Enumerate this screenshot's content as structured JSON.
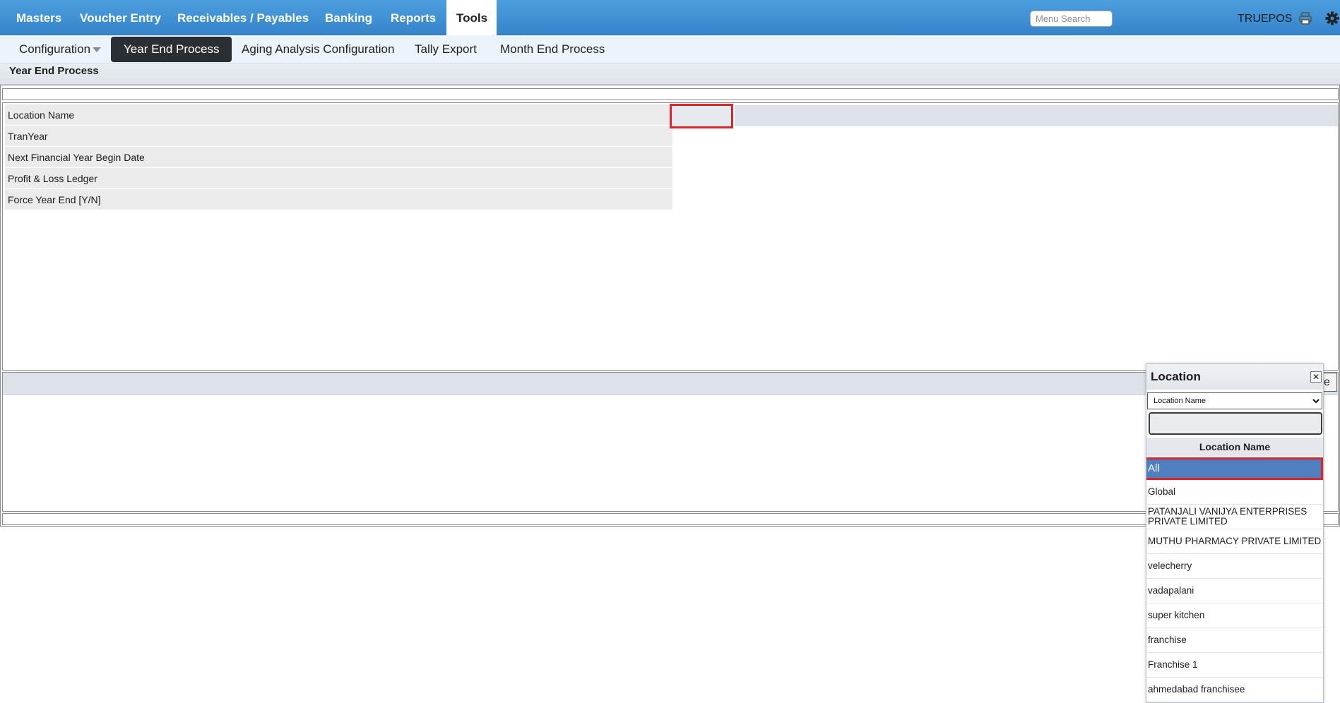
{
  "topnav": {
    "tabs": [
      {
        "label": "Masters"
      },
      {
        "label": "Voucher Entry"
      },
      {
        "label": "Receivables / Payables"
      },
      {
        "label": "Banking"
      },
      {
        "label": "Reports"
      },
      {
        "label": "Tools"
      }
    ],
    "active_tab": "Tools",
    "search_placeholder": "Menu Search",
    "brand": "TRUEPOS",
    "icons": [
      "printer-icon",
      "gear-icon"
    ]
  },
  "subnav": {
    "items": [
      {
        "label": "Configuration"
      },
      {
        "label": "Year End Process"
      },
      {
        "label": "Aging Analysis Configuration"
      },
      {
        "label": "Tally Export"
      },
      {
        "label": "Month End Process"
      }
    ],
    "active_item": "Year End Process"
  },
  "page": {
    "title": "Year End Process"
  },
  "form": {
    "fields": [
      {
        "label": "Location Name",
        "value": ""
      },
      {
        "label": "TranYear",
        "value": ""
      },
      {
        "label": "Next Financial Year Begin Date",
        "value": ""
      },
      {
        "label": "Profit & Loss Ledger",
        "value": ""
      },
      {
        "label": "Force Year End [Y/N]",
        "value": ""
      }
    ]
  },
  "hidden_button_label": "e",
  "popup": {
    "title": "Location",
    "close_icon": "close-icon",
    "select_value": "Location Name",
    "search_value": "",
    "column_header": "Location Name",
    "selected": "All",
    "items": [
      {
        "label": "All"
      },
      {
        "label": "Global"
      },
      {
        "label": "PATANJALI VANIJYA ENTERPRISES PRIVATE LIMITED"
      },
      {
        "label": "MUTHU PHARMACY PRIVATE LIMITED"
      },
      {
        "label": "velecherry"
      },
      {
        "label": "vadapalani"
      },
      {
        "label": "super kitchen"
      },
      {
        "label": "franchise"
      },
      {
        "label": "Franchise 1"
      },
      {
        "label": "ahmedabad franchisee"
      }
    ]
  }
}
